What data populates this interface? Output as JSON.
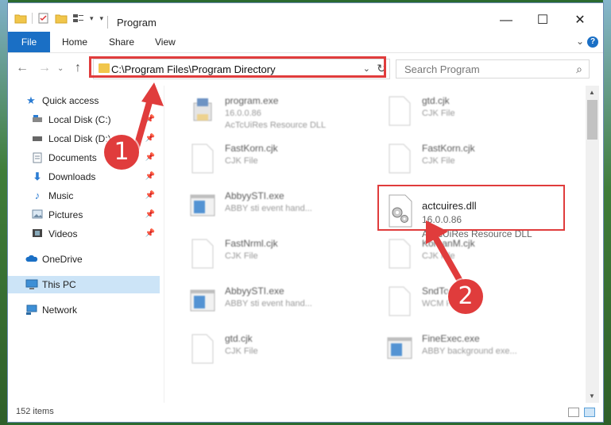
{
  "window": {
    "title": "Program",
    "controls": {
      "minimize": "—",
      "maximize": "☐",
      "close": "✕"
    }
  },
  "ribbon": {
    "tabs": [
      "File",
      "Home",
      "Share",
      "View"
    ],
    "help": "?"
  },
  "nav": {
    "address": "C:\\Program Files\\Program Directory",
    "search_placeholder": "Search Program"
  },
  "sidebar": {
    "items": [
      {
        "label": "Quick access",
        "icon": "star-icon",
        "pinned": false
      },
      {
        "label": "Local Disk (C:)",
        "icon": "drive-icon",
        "pinned": true
      },
      {
        "label": "Local Disk (D:)",
        "icon": "drive-icon",
        "pinned": true
      },
      {
        "label": "Documents",
        "icon": "documents-icon",
        "pinned": true
      },
      {
        "label": "Downloads",
        "icon": "downloads-icon",
        "pinned": true
      },
      {
        "label": "Music",
        "icon": "music-icon",
        "pinned": true
      },
      {
        "label": "Pictures",
        "icon": "pictures-icon",
        "pinned": true
      },
      {
        "label": "Videos",
        "icon": "videos-icon",
        "pinned": true
      },
      {
        "label": "OneDrive",
        "icon": "cloud-icon",
        "pinned": false
      },
      {
        "label": "This PC",
        "icon": "computer-icon",
        "pinned": false
      },
      {
        "label": "Network",
        "icon": "network-icon",
        "pinned": false
      }
    ]
  },
  "files": [
    {
      "name": "program.exe",
      "sub1": "16.0.0.86",
      "sub2": "AcTcUiRes Resource DLL",
      "icon": "exe-icon"
    },
    {
      "name": "gtd.cjk",
      "sub1": "CJK File",
      "sub2": "",
      "icon": "blank-file-icon"
    },
    {
      "name": "FastKorn.cjk",
      "sub1": "CJK File",
      "sub2": "",
      "icon": "blank-file-icon"
    },
    {
      "name": "FastKorn.cjk",
      "sub1": "CJK File",
      "sub2": "",
      "icon": "blank-file-icon"
    },
    {
      "name": "AbbyySTI.exe",
      "sub1": "ABBY sti event hand...",
      "sub2": "",
      "icon": "app-window-icon"
    },
    {
      "name": "actcuires.dll",
      "sub1": "16.0.0.86",
      "sub2": "AcTcUiRes Resource DLL",
      "icon": "dll-gear-icon"
    },
    {
      "name": "FastNrml.cjk",
      "sub1": "CJK File",
      "sub2": "",
      "icon": "blank-file-icon"
    },
    {
      "name": "KoreanM.cjk",
      "sub1": "CJK File",
      "sub2": "",
      "icon": "blank-file-icon"
    },
    {
      "name": "AbbyySTI.exe",
      "sub1": "ABBY sti event hand...",
      "sub2": "",
      "icon": "app-window-icon"
    },
    {
      "name": "SndTo...wcm",
      "sub1": "WCM File",
      "sub2": "",
      "icon": "blank-file-icon"
    },
    {
      "name": "gtd.cjk",
      "sub1": "CJK File",
      "sub2": "",
      "icon": "blank-file-icon"
    },
    {
      "name": "FineExec.exe",
      "sub1": "ABBY background exe...",
      "sub2": "",
      "icon": "app-window-icon"
    }
  ],
  "status": {
    "items": "152 items"
  },
  "markers": {
    "one": "1",
    "two": "2"
  },
  "colors": {
    "accent": "#1a6fc5",
    "highlight": "#e03c3c",
    "selection": "#cce4f7"
  }
}
